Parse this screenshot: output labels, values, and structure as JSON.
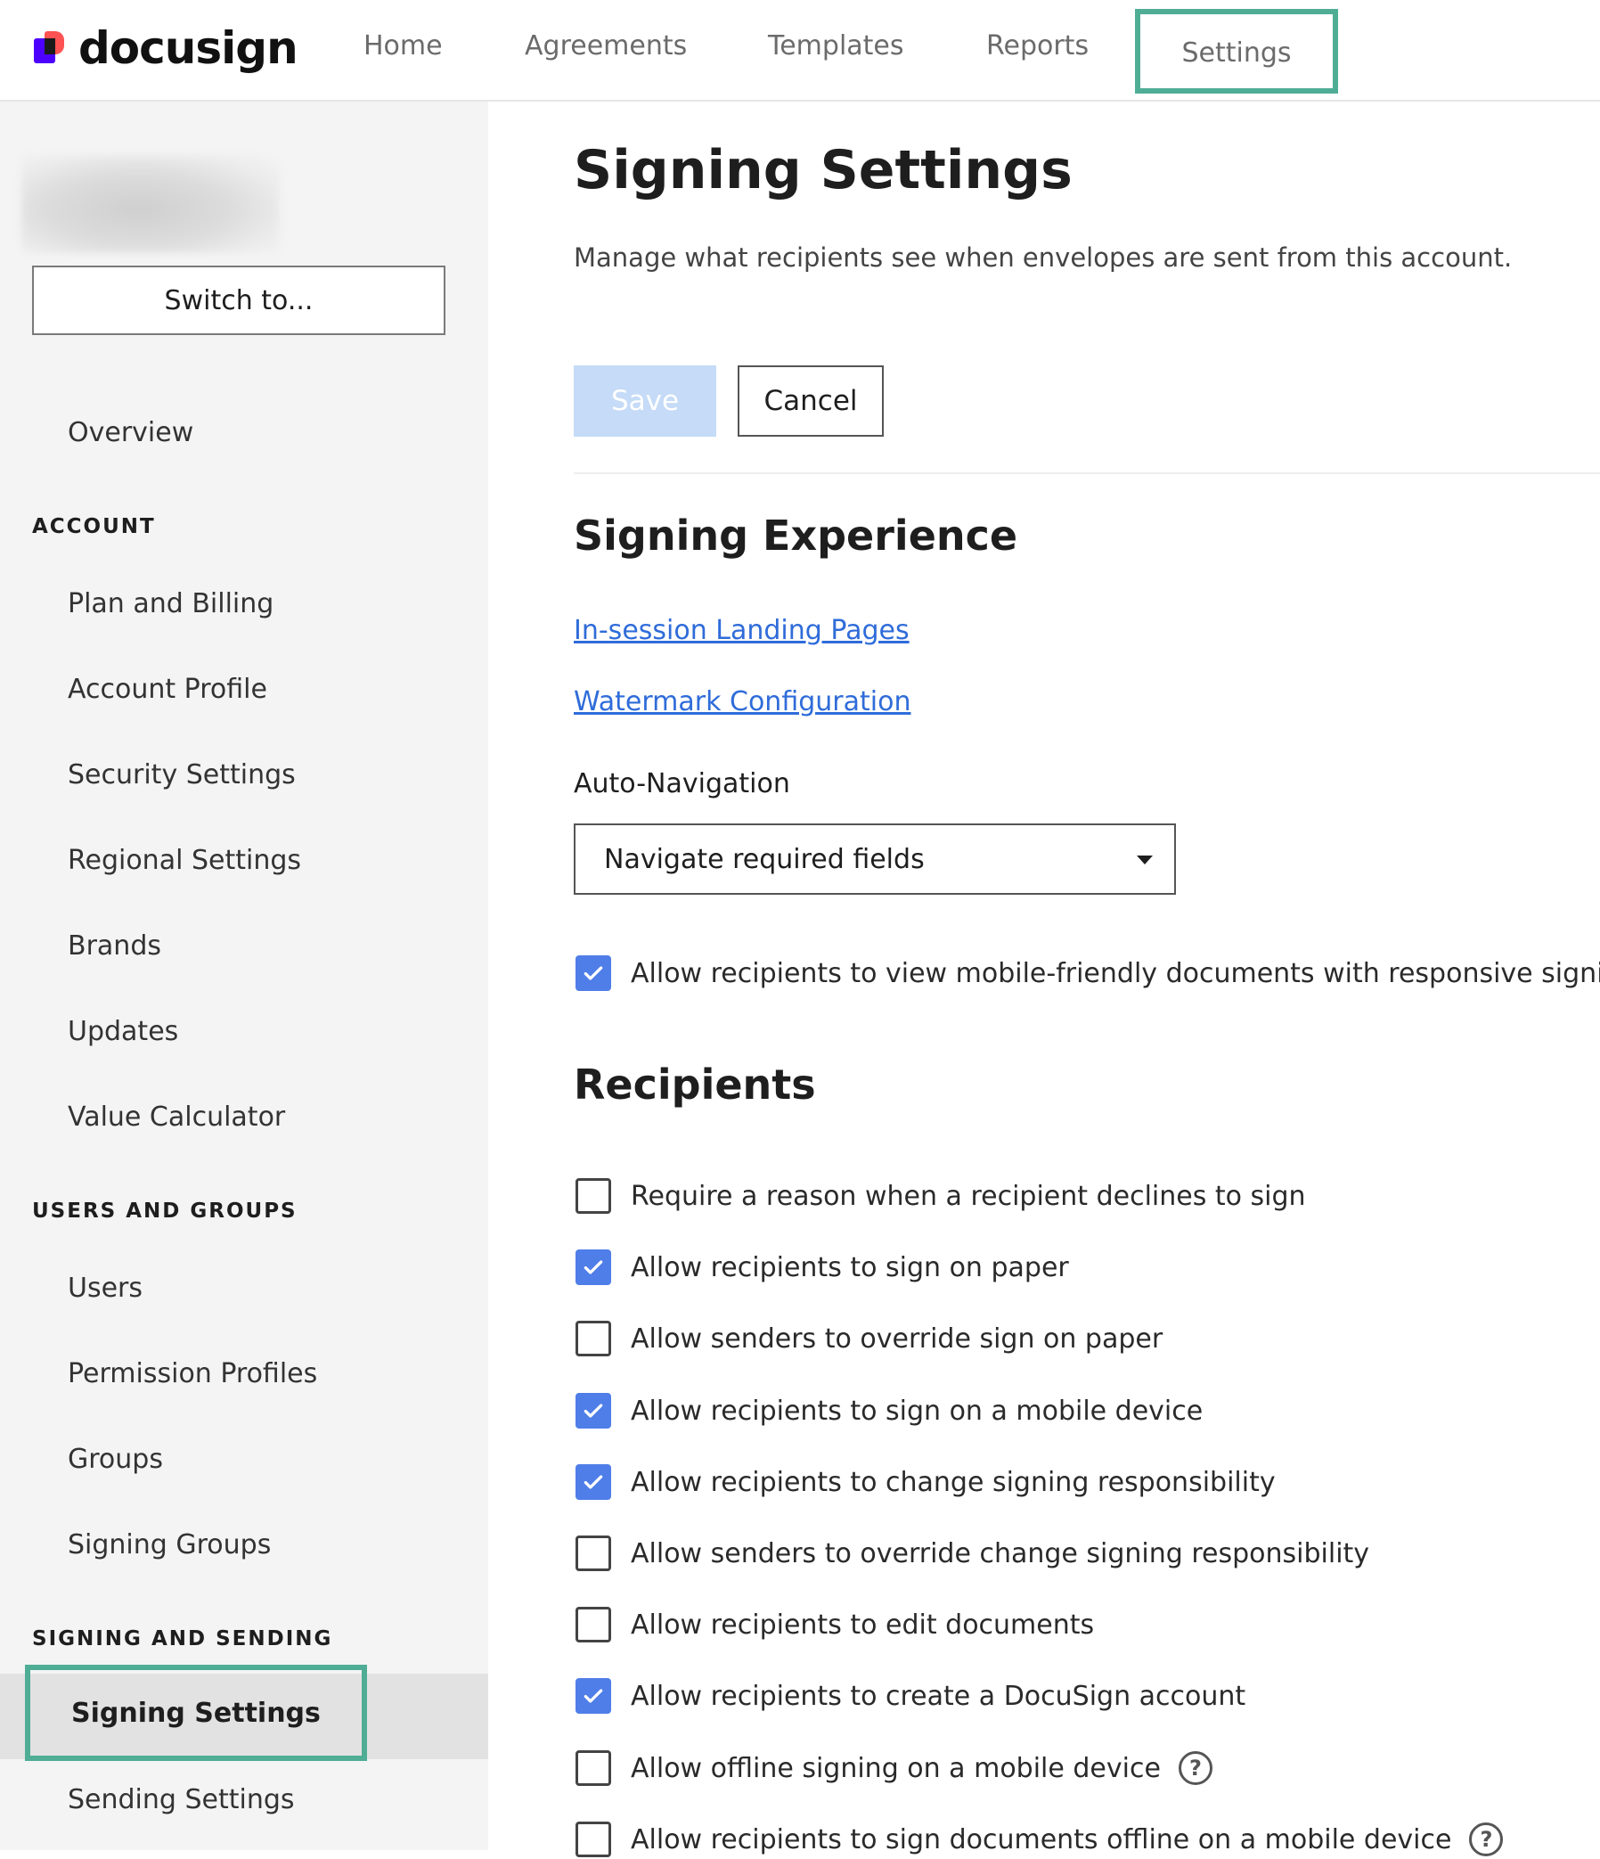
{
  "brand": {
    "logo_text": "docusign"
  },
  "nav": {
    "items": [
      {
        "label": "Home"
      },
      {
        "label": "Agreements"
      },
      {
        "label": "Templates"
      },
      {
        "label": "Reports"
      },
      {
        "label": "Settings",
        "selected": true
      }
    ]
  },
  "sidebar": {
    "switch_label": "Switch to...",
    "overview": "Overview",
    "sections": [
      {
        "title": "ACCOUNT",
        "items": [
          "Plan and Billing",
          "Account Profile",
          "Security Settings",
          "Regional Settings",
          "Brands",
          "Updates",
          "Value Calculator"
        ]
      },
      {
        "title": "USERS AND GROUPS",
        "items": [
          "Users",
          "Permission Profiles",
          "Groups",
          "Signing Groups"
        ]
      },
      {
        "title": "SIGNING AND SENDING",
        "items": [
          "Signing Settings",
          "Sending Settings"
        ],
        "active": "Signing Settings"
      }
    ]
  },
  "main": {
    "title": "Signing Settings",
    "description": "Manage what recipients see when envelopes are sent from this account.",
    "save_label": "Save",
    "cancel_label": "Cancel",
    "signing_experience": {
      "title": "Signing Experience",
      "links": [
        "In-session Landing Pages",
        "Watermark Configuration"
      ],
      "auto_navigation": {
        "label": "Auto-Navigation",
        "selected": "Navigate required fields"
      },
      "responsive": {
        "label": "Allow recipients to view mobile-friendly documents with responsive signing",
        "checked": true
      }
    },
    "recipients": {
      "title": "Recipients",
      "options": [
        {
          "label": "Require a reason when a recipient declines to sign",
          "checked": false,
          "help": false
        },
        {
          "label": "Allow recipients to sign on paper",
          "checked": true,
          "help": false
        },
        {
          "label": "Allow senders to override sign on paper",
          "checked": false,
          "help": false
        },
        {
          "label": "Allow recipients to sign on a mobile device",
          "checked": true,
          "help": false
        },
        {
          "label": "Allow recipients to change signing responsibility",
          "checked": true,
          "help": false
        },
        {
          "label": "Allow senders to override change signing responsibility",
          "checked": false,
          "help": false
        },
        {
          "label": "Allow recipients to edit documents",
          "checked": false,
          "help": false
        },
        {
          "label": "Allow recipients to create a DocuSign account",
          "checked": true,
          "help": false
        },
        {
          "label": "Allow offline signing on a mobile device",
          "checked": false,
          "help": true
        },
        {
          "label": "Allow recipients to sign documents offline on a mobile device",
          "checked": false,
          "help": true
        }
      ]
    }
  },
  "colors": {
    "accent_highlight": "#4fad96",
    "checkbox_checked": "#4f7ee8",
    "link": "#2f6cd9",
    "save_disabled": "#c5dbf7"
  }
}
